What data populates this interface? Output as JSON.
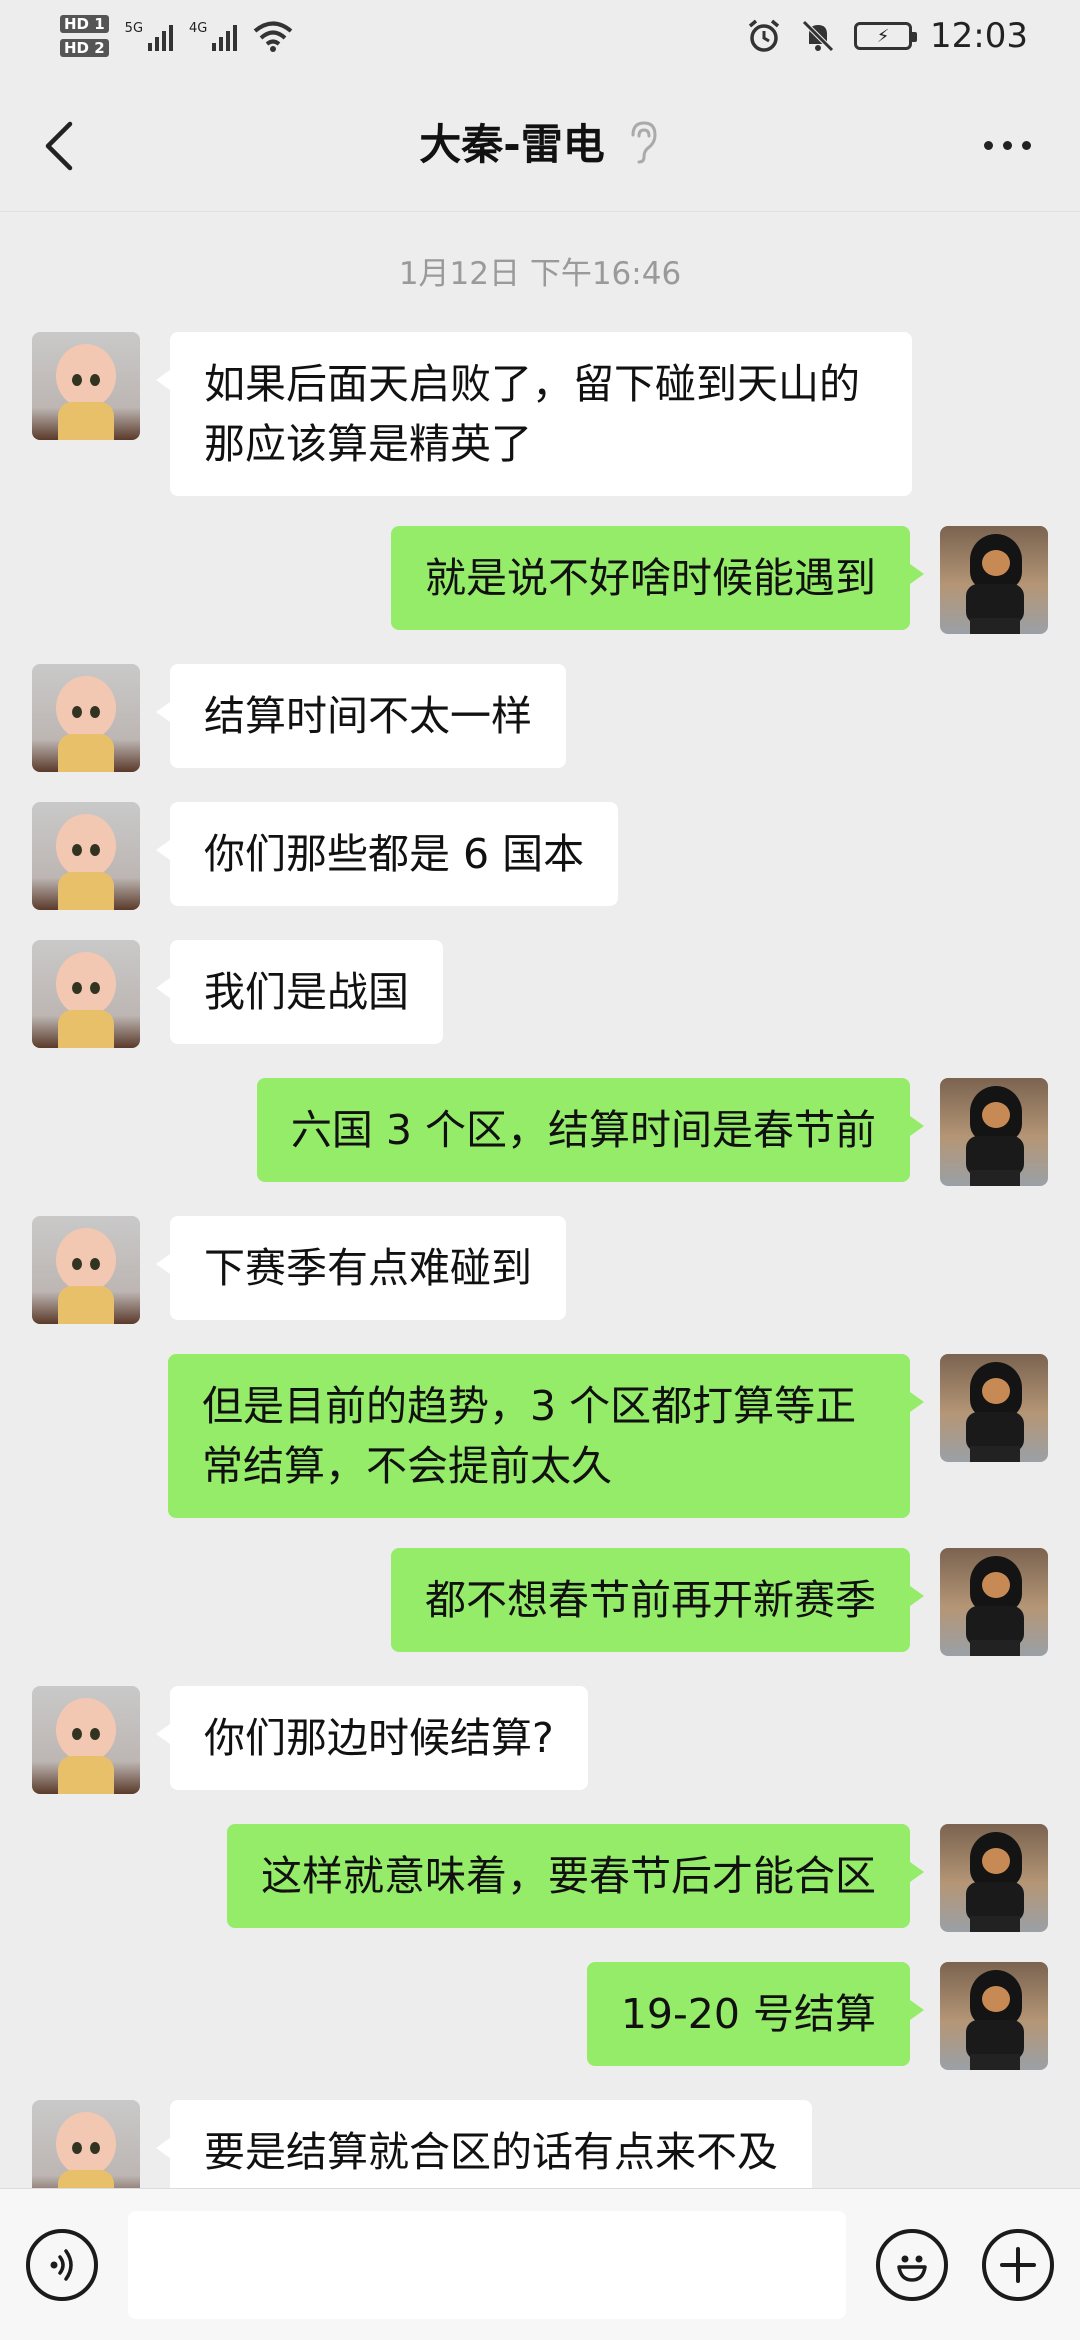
{
  "status_bar": {
    "hd1": "HD 1",
    "hd2": "HD 2",
    "net1": "5G",
    "net2": "4G",
    "time": "12:03"
  },
  "nav": {
    "title": "大秦-雷电"
  },
  "chat": {
    "timestamp": "1月12日 下午16:46",
    "messages": [
      {
        "from": "them",
        "text": "如果后面天启败了，留下碰到天山的那应该算是精英了"
      },
      {
        "from": "me",
        "text": "就是说不好啥时候能遇到"
      },
      {
        "from": "them",
        "text": "结算时间不太一样"
      },
      {
        "from": "them",
        "text": "你们那些都是 6 国本"
      },
      {
        "from": "them",
        "text": "我们是战国"
      },
      {
        "from": "me",
        "text": "六国 3 个区，结算时间是春节前"
      },
      {
        "from": "them",
        "text": "下赛季有点难碰到"
      },
      {
        "from": "me",
        "text": "但是目前的趋势，3 个区都打算等正常结算，不会提前太久"
      },
      {
        "from": "me",
        "text": "都不想春节前再开新赛季"
      },
      {
        "from": "them",
        "text": "你们那边时候结算?"
      },
      {
        "from": "me",
        "text": "这样就意味着，要春节后才能合区"
      },
      {
        "from": "me",
        "text": "19-20 号结算"
      },
      {
        "from": "them",
        "text": "要是结算就合区的话有点来不及"
      }
    ]
  },
  "icons": {
    "back": "back-arrow-icon",
    "ear": "earpiece-mode-icon",
    "more": "more-dots-icon",
    "voice": "voice-input-icon",
    "emoji": "emoji-icon",
    "plus": "plus-icon"
  },
  "colors": {
    "my_bubble": "#95ec69",
    "their_bubble": "#ffffff",
    "chat_background": "#ededed"
  }
}
